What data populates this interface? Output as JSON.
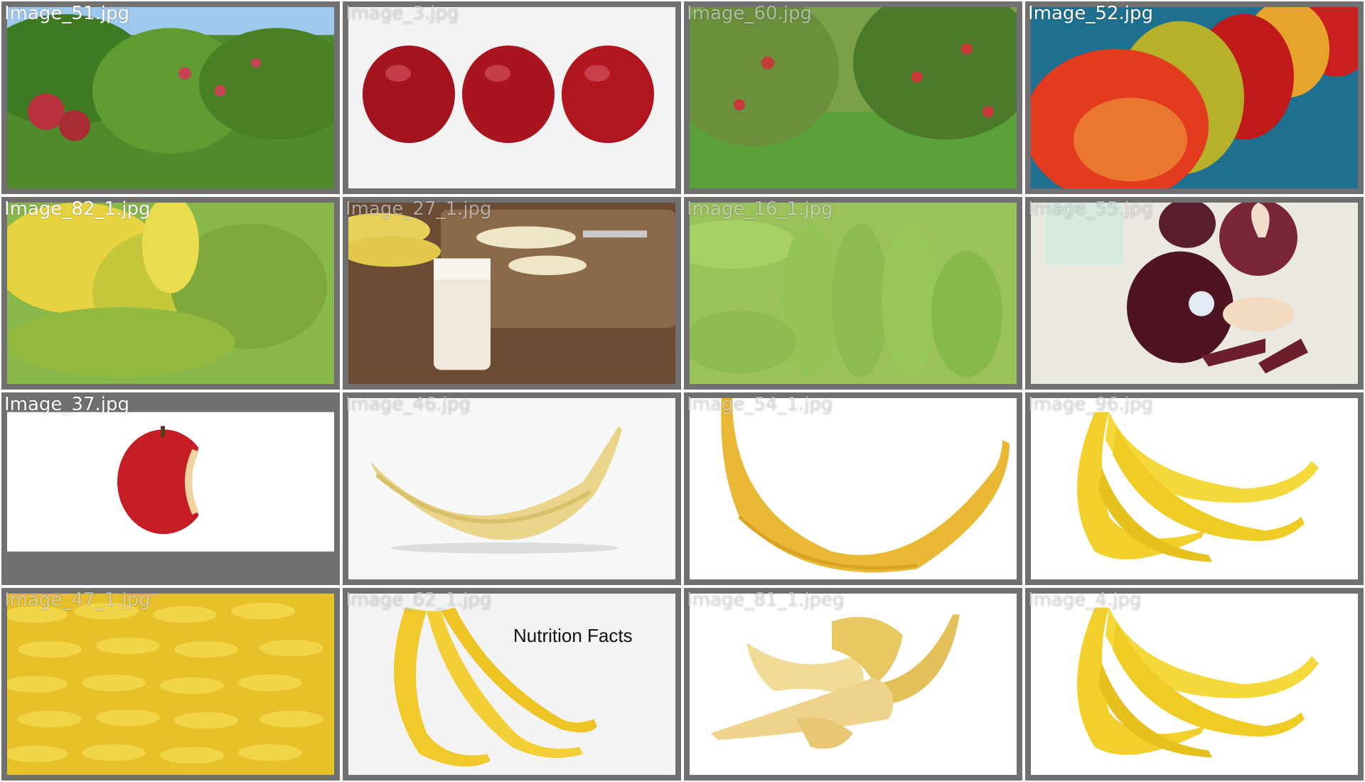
{
  "gallery": {
    "items": [
      {
        "filename": "Image_51.jpg"
      },
      {
        "filename": "Image_3.jpg"
      },
      {
        "filename": "Image_60.jpg"
      },
      {
        "filename": "Image_52.jpg"
      },
      {
        "filename": "Image_82_1.jpg"
      },
      {
        "filename": "Image_27_1.jpg"
      },
      {
        "filename": "Image_16_1.jpg"
      },
      {
        "filename": "Image_55.jpg"
      },
      {
        "filename": "Image_37.jpg"
      },
      {
        "filename": "Image_46.jpg"
      },
      {
        "filename": "Image_54_1.jpg"
      },
      {
        "filename": "Image_96.jpg"
      },
      {
        "filename": "Image_47_1.jpg"
      },
      {
        "filename": "Image_62_1.jpg",
        "overlay_text": "Nutrition Facts"
      },
      {
        "filename": "Image_81_1.jpeg"
      },
      {
        "filename": "Image_4.jpg"
      }
    ]
  },
  "colors": {
    "cell_background": "#707070",
    "caption_text": "#ffffff",
    "page_background": "#ffffff"
  }
}
